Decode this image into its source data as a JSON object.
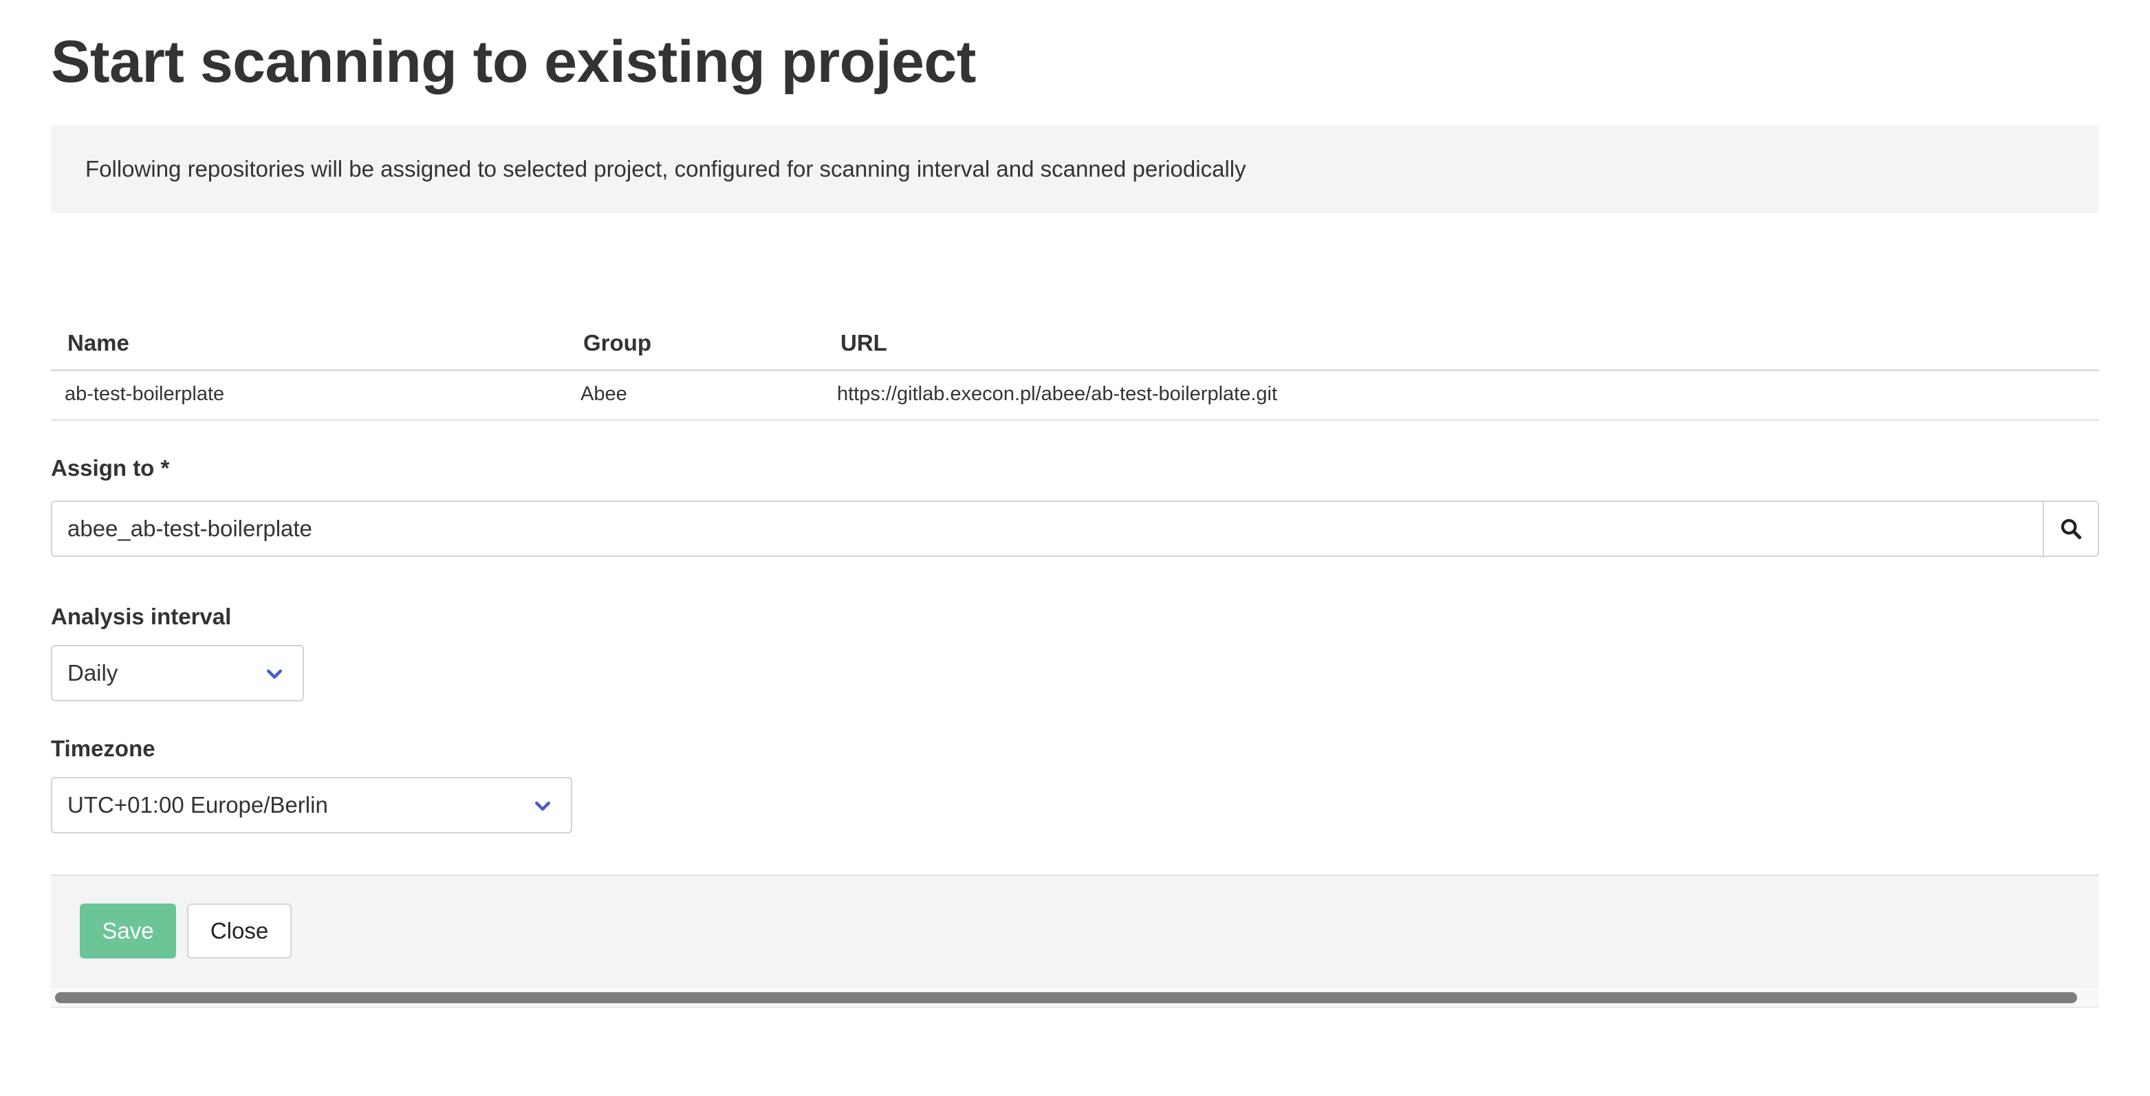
{
  "page": {
    "title": "Start scanning to existing project",
    "info_text": "Following repositories will be assigned to selected project, configured for scanning interval and scanned periodically"
  },
  "table": {
    "columns": [
      "Name",
      "Group",
      "URL"
    ],
    "rows": [
      {
        "name": "ab-test-boilerplate",
        "group": "Abee",
        "url": "https://gitlab.execon.pl/abee/ab-test-boilerplate.git"
      }
    ]
  },
  "assign": {
    "label": "Assign to *",
    "value": "abee_ab-test-boilerplate",
    "search_icon": "search-icon"
  },
  "interval": {
    "label": "Analysis interval",
    "value": "Daily",
    "icon": "chevron-down-icon"
  },
  "timezone": {
    "label": "Timezone",
    "value": "UTC+01:00 Europe/Berlin",
    "icon": "chevron-down-icon"
  },
  "footer": {
    "save_label": "Save",
    "close_label": "Close"
  },
  "colors": {
    "save_button": "#6cc597",
    "chevron": "#4a5cc8",
    "info_background": "#f4f4f4"
  }
}
